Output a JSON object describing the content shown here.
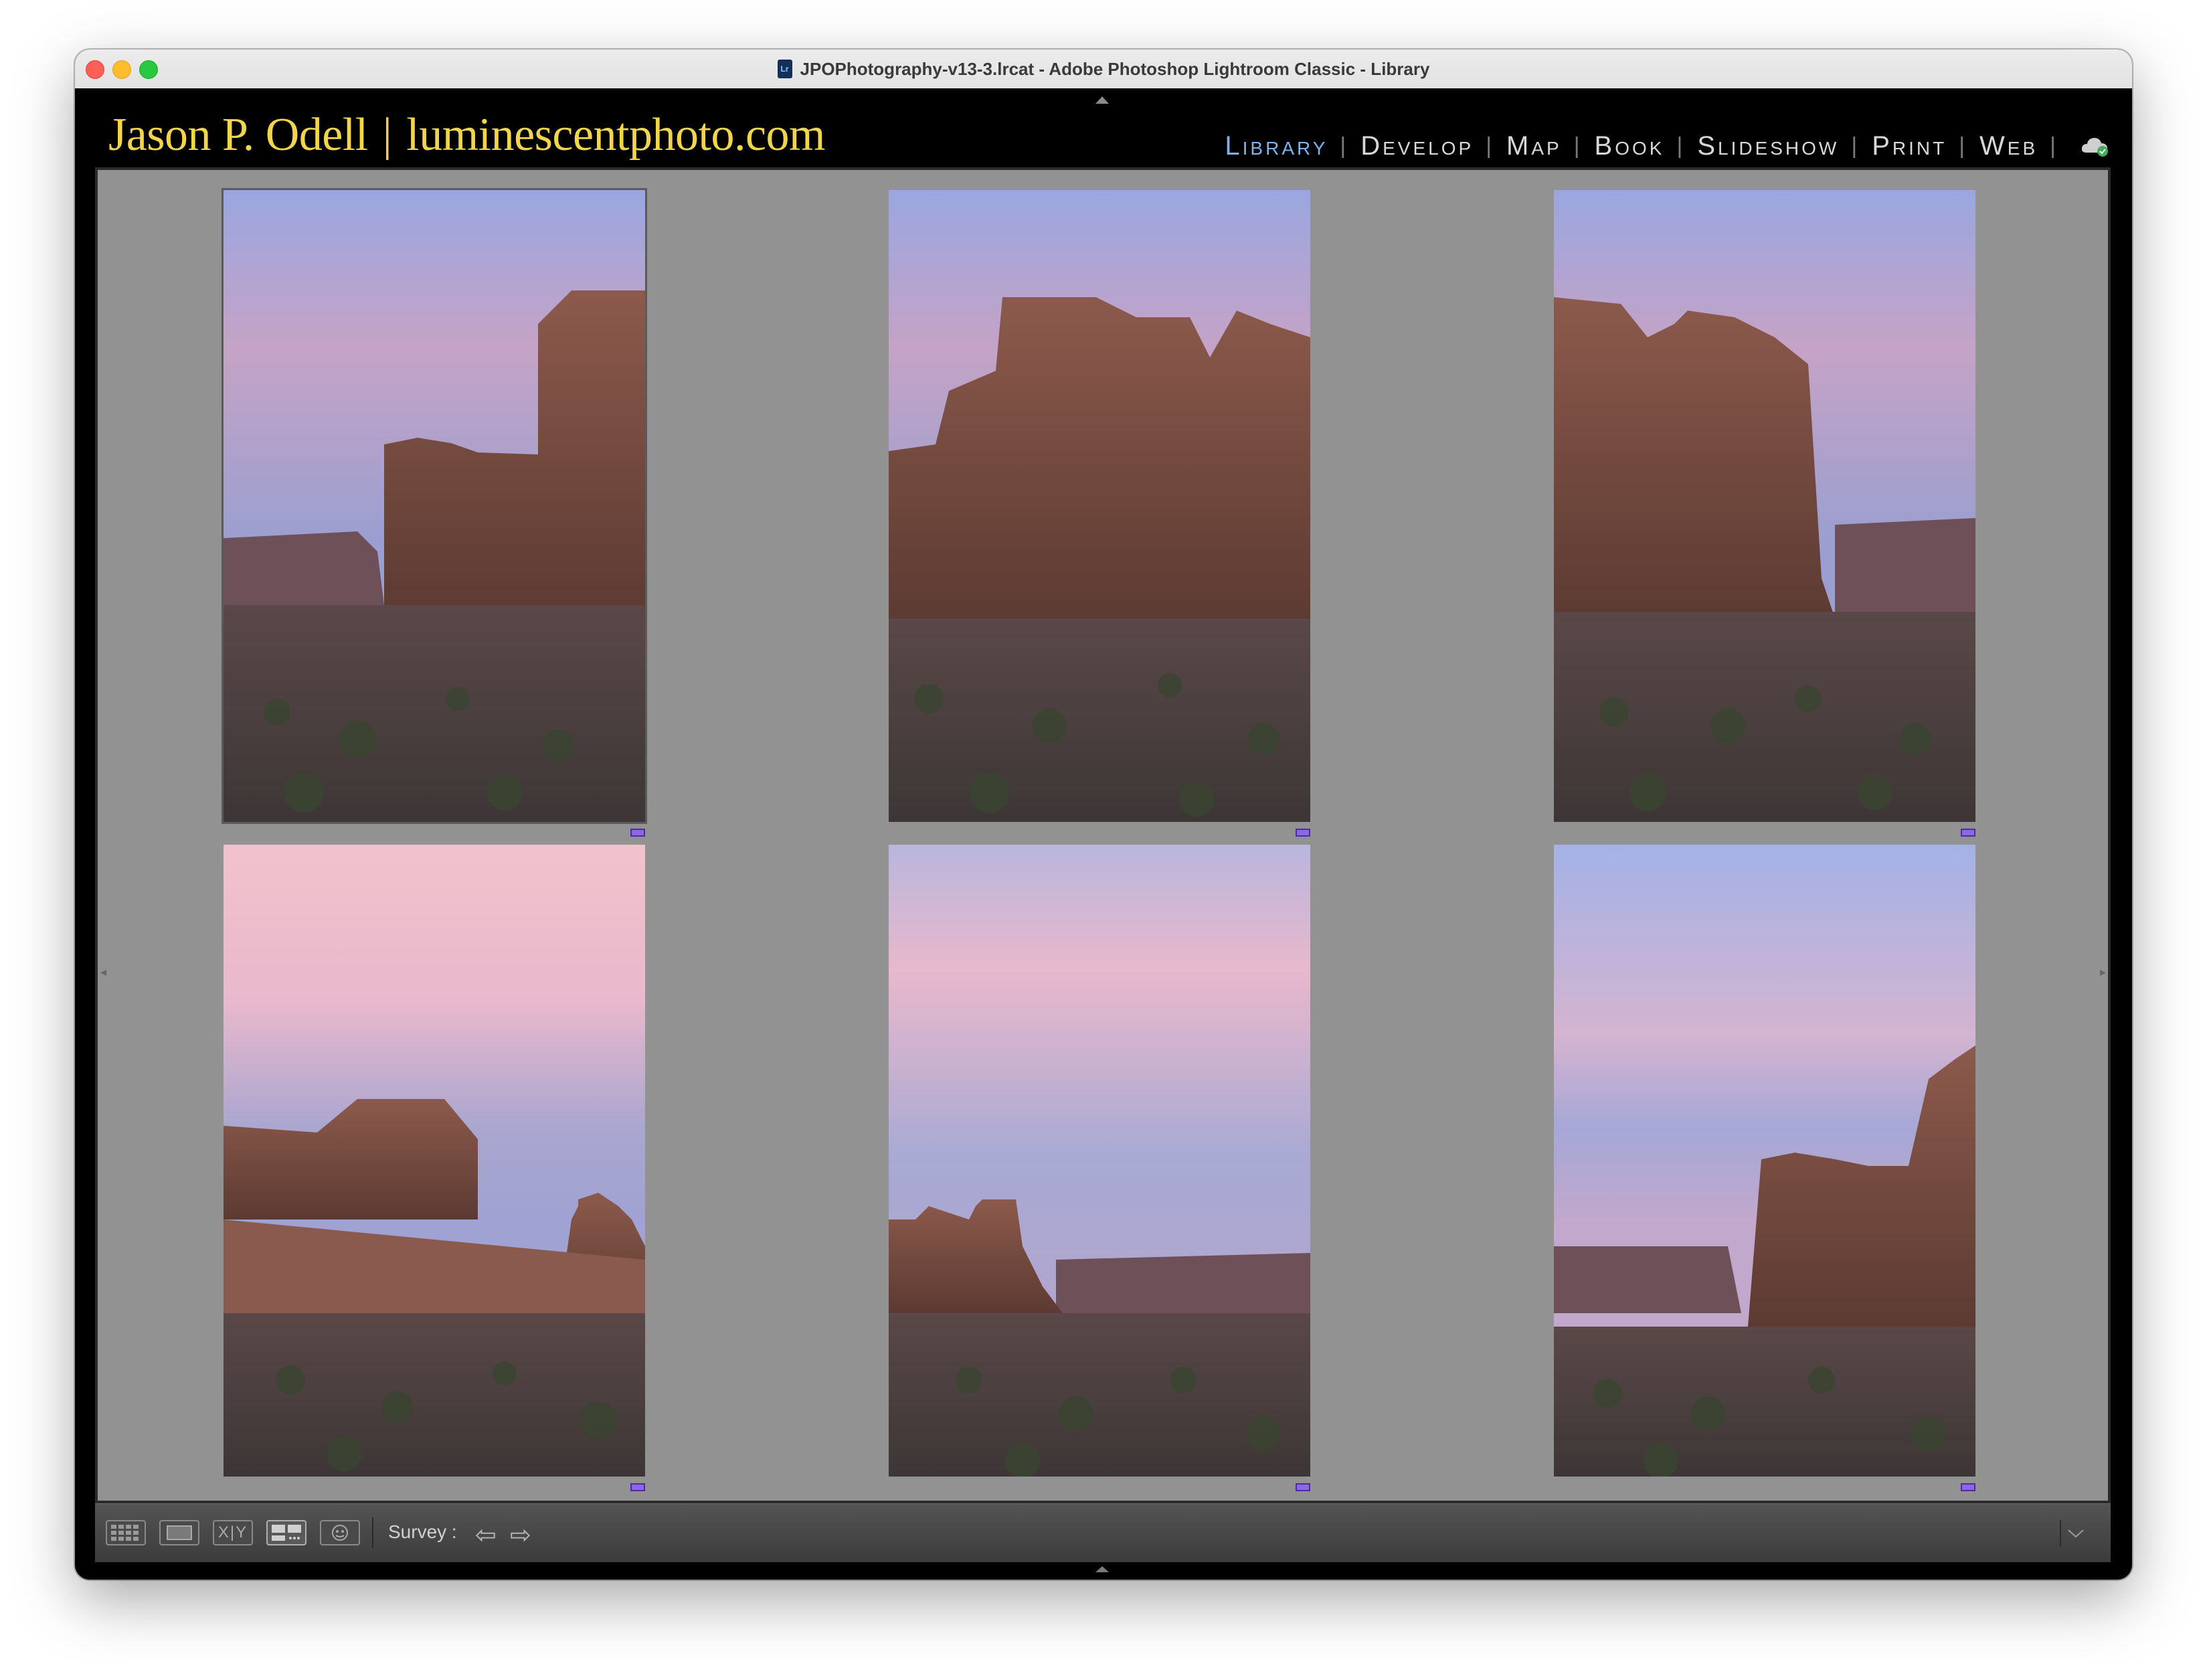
{
  "window": {
    "title": "JPOPhotography-v13-3.lrcat - Adobe Photoshop Lightroom Classic - Library",
    "doc_icon": "Lr"
  },
  "identity_plate": {
    "name": "Jason P. Odell",
    "separator": "|",
    "website": "luminescentphoto.com",
    "color": "#f2d54a"
  },
  "modules": {
    "items": [
      {
        "label": "Library",
        "active": true
      },
      {
        "label": "Develop",
        "active": false
      },
      {
        "label": "Map",
        "active": false
      },
      {
        "label": "Book",
        "active": false
      },
      {
        "label": "Slideshow",
        "active": false
      },
      {
        "label": "Print",
        "active": false
      },
      {
        "label": "Web",
        "active": false
      }
    ],
    "separator": "|",
    "active_color": "#7bb4f0",
    "sync_icon": "cloud-sync-icon"
  },
  "survey": {
    "photos": [
      {
        "name": "courthouse-towers-1",
        "selected": true,
        "flag": "purple"
      },
      {
        "name": "courthouse-towers-2",
        "selected": false,
        "flag": "purple"
      },
      {
        "name": "courthouse-towers-3",
        "selected": false,
        "flag": "purple"
      },
      {
        "name": "three-gossips-1",
        "selected": false,
        "flag": "purple"
      },
      {
        "name": "sheep-rock-1",
        "selected": false,
        "flag": "purple"
      },
      {
        "name": "courthouse-towers-4",
        "selected": false,
        "flag": "purple"
      }
    ]
  },
  "toolbar": {
    "view_buttons": [
      "grid-view-icon",
      "loupe-view-icon",
      "compare-view-icon",
      "survey-view-icon",
      "people-view-icon"
    ],
    "compare_label": "X|Y",
    "mode_label": "Survey :",
    "prev_icon": "arrow-left-icon",
    "next_icon": "arrow-right-icon",
    "menu_icon": "chevron-down-icon"
  }
}
